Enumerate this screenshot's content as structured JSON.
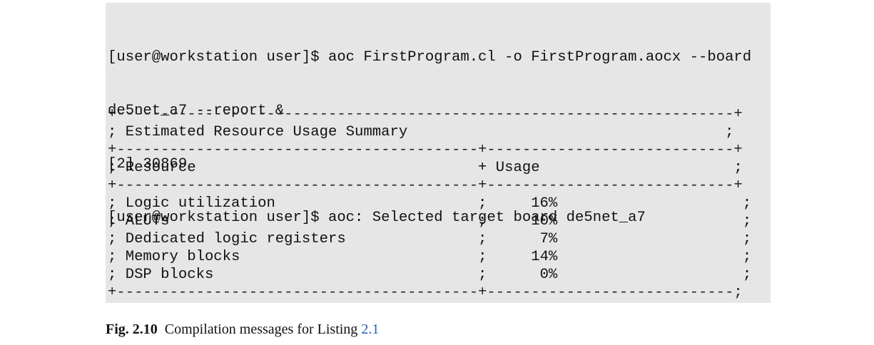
{
  "terminal": {
    "lines": [
      "[user@workstation user]$ aoc FirstProgram.cl -o FirstProgram.aocx --board",
      "de5net_a7 --report &",
      "[2] 30869",
      "[user@workstation user]$ aoc: Selected target board de5net_a7"
    ],
    "background": "#e6e6e6"
  },
  "report": {
    "title": "Estimated Resource Usage Summary",
    "headers": [
      "Resource",
      "Usage"
    ],
    "rows": [
      {
        "resource": "Logic utilization",
        "usage": "16%"
      },
      {
        "resource": "ALUTs",
        "usage": "10%"
      },
      {
        "resource": "Dedicated logic registers",
        "usage": "7%"
      },
      {
        "resource": "Memory blocks",
        "usage": "14%"
      },
      {
        "resource": "DSP blocks",
        "usage": "0%"
      }
    ]
  },
  "caption": {
    "label": "Fig. 2.10",
    "text": "Compilation messages for Listing ",
    "link": "2.1",
    "link_color": "#2a5db0"
  }
}
